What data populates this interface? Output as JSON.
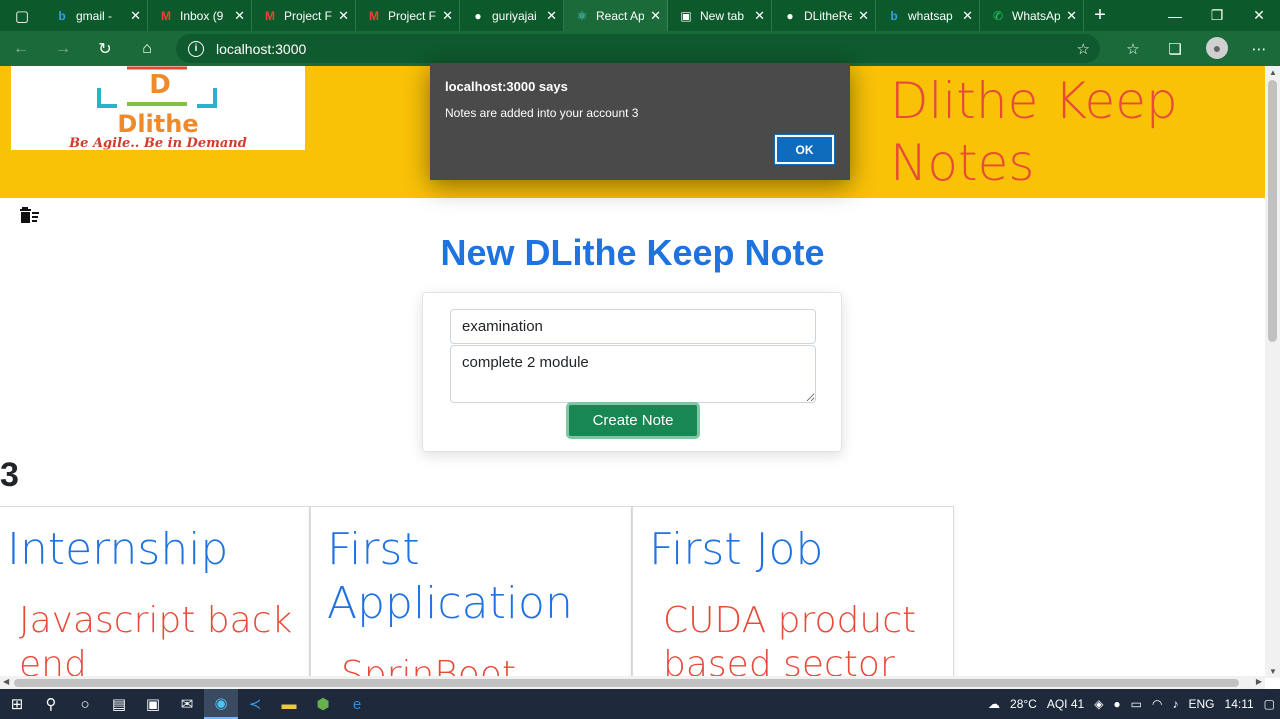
{
  "browser": {
    "tabs": [
      {
        "label": "gmail - ",
        "icon": "bing-icon",
        "glyph": "b",
        "color": "#2ea3e6"
      },
      {
        "label": "Inbox (9",
        "icon": "gmail-icon",
        "glyph": "M",
        "color": "#ea4335"
      },
      {
        "label": "Project F",
        "icon": "gmail-icon",
        "glyph": "M",
        "color": "#ea4335"
      },
      {
        "label": "Project F",
        "icon": "gmail-icon",
        "glyph": "M",
        "color": "#ea4335"
      },
      {
        "label": "guriyajai",
        "icon": "github-icon",
        "glyph": "●",
        "color": "#ffffff"
      },
      {
        "label": "React Ap",
        "icon": "react-icon",
        "glyph": "⚛",
        "color": "#61dafb",
        "active": true
      },
      {
        "label": "New tab",
        "icon": "newtab-icon",
        "glyph": "▣",
        "color": "#ffffff"
      },
      {
        "label": "DLitheRe",
        "icon": "github-icon",
        "glyph": "●",
        "color": "#ffffff"
      },
      {
        "label": "whatsap",
        "icon": "bing-icon",
        "glyph": "b",
        "color": "#2ea3e6"
      },
      {
        "label": "WhatsAp",
        "icon": "whatsapp-icon",
        "glyph": "✆",
        "color": "#25d366"
      }
    ],
    "address": "localhost:3000"
  },
  "header": {
    "logo_letter": "D",
    "logo_brand": "Dlithe",
    "logo_tagline": "Be Agile.. Be in Demand",
    "app_title": "Dlithe Keep Notes"
  },
  "form": {
    "heading": "New DLithe Keep Note",
    "title_value": "examination",
    "body_value": "complete 2 module",
    "submit_label": "Create Note"
  },
  "notes_count": "3",
  "notes": [
    {
      "title": "Internship",
      "body": "Javascript back end"
    },
    {
      "title": "First Application",
      "body": "SprinBoot"
    },
    {
      "title": "First Job",
      "body": "CUDA product based sector"
    }
  ],
  "alert": {
    "title": "localhost:3000 says",
    "message": "Notes are added into your account 3",
    "ok_label": "OK"
  },
  "taskbar": {
    "weather": "28°C",
    "aqi": "AQI 41",
    "lang": "ENG",
    "time": "14:11"
  },
  "colors": {
    "header_bg": "#f9c207",
    "title_red": "#e84a3a",
    "accent_blue": "#1f73e0",
    "button_green": "#198754",
    "browser_green": "#1b6b3a"
  }
}
